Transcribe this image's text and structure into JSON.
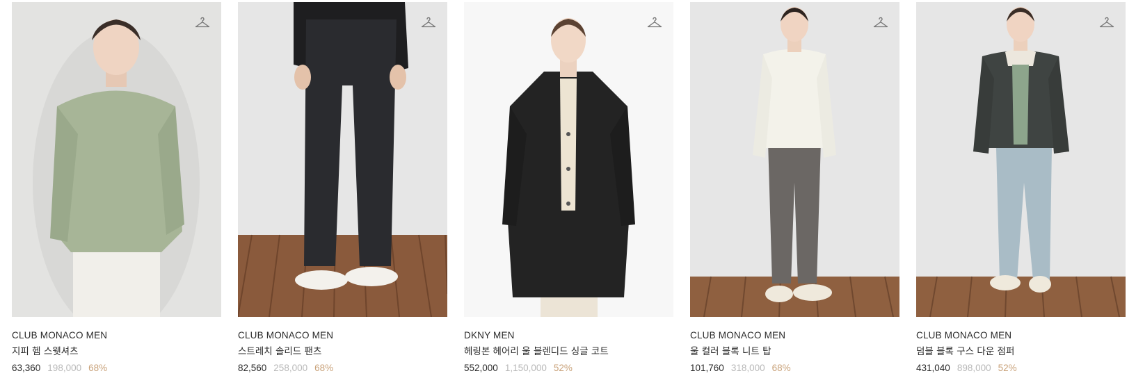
{
  "products": [
    {
      "brand": "CLUB MONACO MEN",
      "name": "지피 헴 스웻셔츠",
      "sale_price": "63,360",
      "original_price": "198,000",
      "discount": "68%",
      "image_icon": "model-sage-sweatshirt-image"
    },
    {
      "brand": "CLUB MONACO MEN",
      "name": "스트레치 솔리드 팬츠",
      "sale_price": "82,560",
      "original_price": "258,000",
      "discount": "68%",
      "image_icon": "model-black-pants-image"
    },
    {
      "brand": "DKNY MEN",
      "name": "헤링본 헤어리 울 블렌디드 싱글 코트",
      "sale_price": "552,000",
      "original_price": "1,150,000",
      "discount": "52%",
      "image_icon": "model-black-coat-image"
    },
    {
      "brand": "CLUB MONACO MEN",
      "name": "울 컬러 블록 니트 탑",
      "sale_price": "101,760",
      "original_price": "318,000",
      "discount": "68%",
      "image_icon": "model-white-knit-image"
    },
    {
      "brand": "CLUB MONACO MEN",
      "name": "덤블 블록 구스 다운 점퍼",
      "sale_price": "431,040",
      "original_price": "898,000",
      "discount": "52%",
      "image_icon": "model-down-jumper-image"
    }
  ],
  "wishlist_icon": "hanger-icon",
  "colors": {
    "text": "#2a2a2a",
    "original_price": "#b8b8b8",
    "discount": "#c9a27a"
  }
}
